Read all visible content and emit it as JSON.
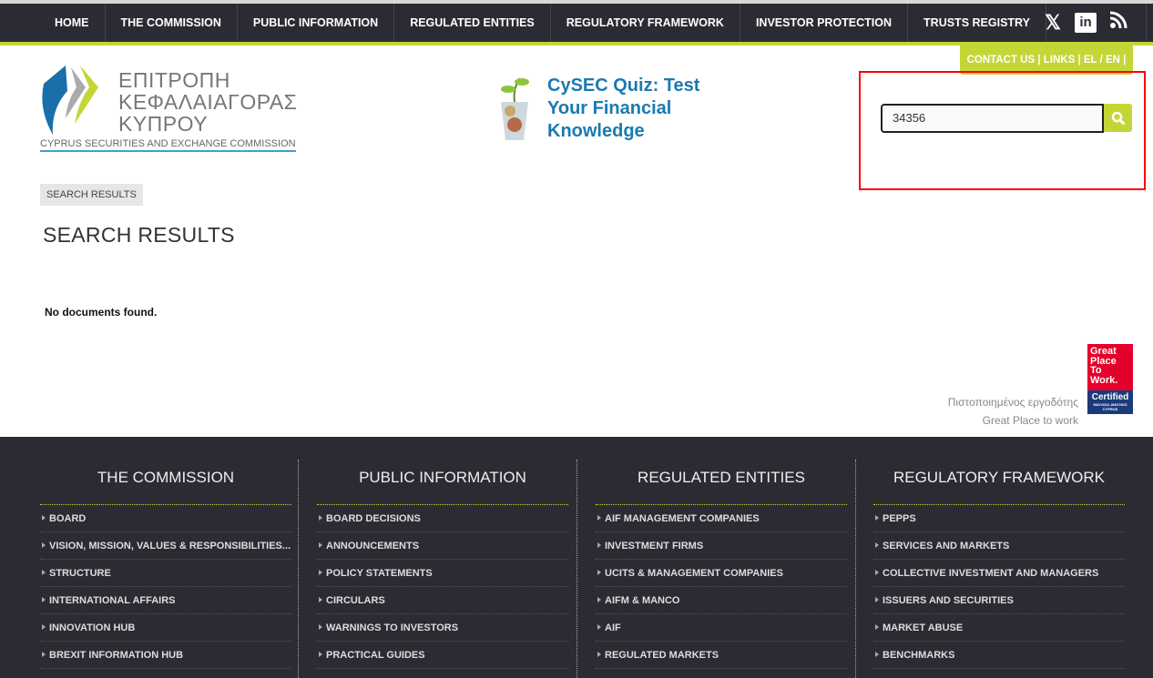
{
  "nav": {
    "items": [
      "HOME",
      "THE COMMISSION",
      "PUBLIC INFORMATION",
      "REGULATED ENTITIES",
      "REGULATORY FRAMEWORK",
      "INVESTOR PROTECTION",
      "TRUSTS REGISTRY"
    ]
  },
  "social": {
    "x": "𝕏",
    "linkedin": "in",
    "rss": "RSS"
  },
  "utility": {
    "contact": "CONTACT US",
    "links": "LINKS",
    "lang": "EL / EN",
    "sep": "|"
  },
  "logo": {
    "greek1": "ΕΠΙΤΡΟΠΗ",
    "greek2": "ΚΕΦΑΛΑΙΑΓΟΡΑΣ",
    "greek3": "ΚΥΠΡΟΥ",
    "english": "CYPRUS SECURITIES AND EXCHANGE COMMISSION"
  },
  "quiz": {
    "text": "CySEC Quiz: Test Your Financial Knowledge"
  },
  "search": {
    "value": "34356"
  },
  "breadcrumb": "SEARCH RESULTS",
  "page_title": "SEARCH RESULTS",
  "results_message": "No documents found.",
  "gptw": {
    "line1": "Πιστοποιημένος εργοδότης",
    "line2": "Great Place to work",
    "badge_top": "Great Place To Work.",
    "badge_bottom": "Certified",
    "badge_dates": "MAY2022–MAY2023",
    "badge_country": "CYPRUS"
  },
  "colors": {
    "dark": "#2b2c33",
    "lime": "#c4d636",
    "blue": "#1a7ab0"
  },
  "footer": {
    "columns": [
      {
        "title": "THE COMMISSION",
        "items": [
          "BOARD",
          "VISION, MISSION, VALUES & RESPONSIBILITIES...",
          "STRUCTURE",
          "INTERNATIONAL AFFAIRS",
          "INNOVATION HUB",
          "BREXIT INFORMATION HUB"
        ]
      },
      {
        "title": "PUBLIC INFORMATION",
        "items": [
          "BOARD DECISIONS",
          "ANNOUNCEMENTS",
          "POLICY STATEMENTS",
          "CIRCULARS",
          "WARNINGS TO INVESTORS",
          "PRACTICAL GUIDES"
        ]
      },
      {
        "title": "REGULATED ENTITIES",
        "items": [
          "AIF MANAGEMENT COMPANIES",
          "INVESTMENT FIRMS",
          "UCITS & MANAGEMENT COMPANIES",
          "AIFM & MANCO",
          "AIF",
          "REGULATED MARKETS"
        ]
      },
      {
        "title": "REGULATORY FRAMEWORK",
        "items": [
          "PEPPS",
          "SERVICES AND MARKETS",
          "COLLECTIVE INVESTMENT AND MANAGERS",
          "ISSUERS AND SECURITIES",
          "MARKET ABUSE",
          "BENCHMARKS"
        ]
      }
    ]
  }
}
